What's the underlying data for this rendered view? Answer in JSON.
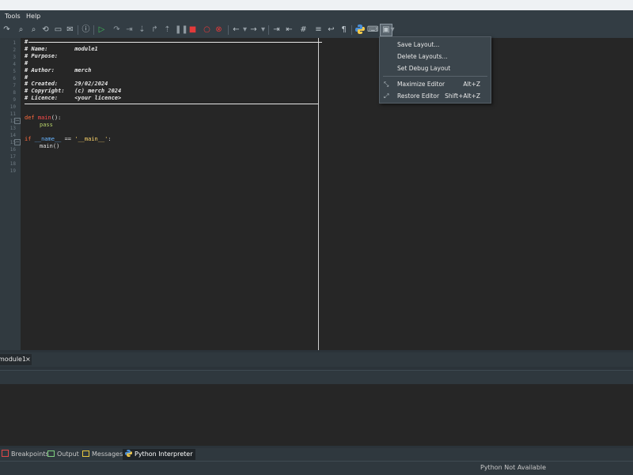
{
  "menu": [
    "Tools",
    "Help"
  ],
  "toolbar_icons": [
    "redo-icon",
    "find-icon",
    "find-in-files-icon",
    "replace-icon",
    "open-folder-icon",
    "mail-icon",
    "info-icon",
    "run-icon",
    "step-over-icon",
    "run-to-cursor-icon",
    "step-into-icon",
    "step-out-icon",
    "pause-icon",
    "stop-icon",
    "breakpoint-icon",
    "clear-breakpoints-icon",
    "back-icon",
    "forward-icon",
    "indent-icon",
    "unindent-icon",
    "comment-icon",
    "numbered-list-icon",
    "wrap-icon",
    "pilcrow-icon",
    "python-icon",
    "keyboard-icon",
    "layout-icon"
  ],
  "line_numbers": [
    "1",
    "2",
    "3",
    "4",
    "5",
    "6",
    "7",
    "8",
    "9",
    "10",
    "11",
    "12",
    "13",
    "14",
    "15",
    "16",
    "17",
    "18",
    "19"
  ],
  "code": {
    "header": [
      "#",
      "# Name:        module1",
      "# Purpose:",
      "#",
      "# Author:      merch",
      "#",
      "# Created:     29/02/2024",
      "# Copyright:   (c) merch 2024",
      "# Licence:     <your licence>"
    ],
    "def_kw": "def",
    "func_name": "main",
    "def_rest": "():",
    "pass_kw": "pass",
    "if_kw": "if",
    "dunder": "__name__",
    "eq": " == ",
    "main_str": "'__main__'",
    "colon": ":",
    "call": "main()"
  },
  "dropdown": {
    "items": [
      {
        "label": "Save Layout...",
        "shortcut": ""
      },
      {
        "label": "Delete Layouts...",
        "shortcut": ""
      },
      {
        "label": "Set Debug Layout",
        "shortcut": ""
      },
      {
        "label": "Maximize Editor",
        "shortcut": "Alt+Z"
      },
      {
        "label": "Restore Editor",
        "shortcut": "Shift+Alt+Z"
      }
    ]
  },
  "doc_tab": {
    "label": "module1",
    "close": "×"
  },
  "panel_tabs": [
    "Breakpoints",
    "Output",
    "Messages",
    "Python Interpreter"
  ],
  "status": "Python Not Available"
}
